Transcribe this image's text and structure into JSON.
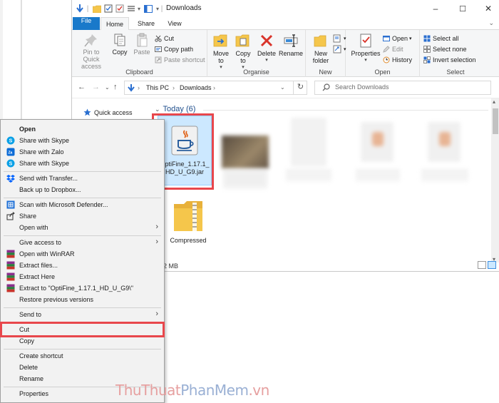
{
  "window": {
    "title": "Downloads",
    "controls": {
      "minimize": "–",
      "maximize": "☐",
      "close": "✕"
    }
  },
  "tabs": [
    {
      "label": "File"
    },
    {
      "label": "Home"
    },
    {
      "label": "Share"
    },
    {
      "label": "View"
    }
  ],
  "ribbon": {
    "clipboard": {
      "label": "Clipboard",
      "pin": "Pin to Quick access",
      "copy": "Copy",
      "paste": "Paste",
      "cut": "Cut",
      "copy_path": "Copy path",
      "paste_shortcut": "Paste shortcut"
    },
    "organise": {
      "label": "Organise",
      "move_to": "Move to",
      "copy_to": "Copy to",
      "delete": "Delete",
      "rename": "Rename"
    },
    "new": {
      "label": "New",
      "new_folder": "New folder"
    },
    "open": {
      "label": "Open",
      "properties": "Properties",
      "open": "Open",
      "edit": "Edit",
      "history": "History"
    },
    "select": {
      "label": "Select",
      "select_all": "Select all",
      "select_none": "Select none",
      "invert": "Invert selection"
    }
  },
  "address": {
    "crumbs": [
      "This PC",
      "Downloads"
    ],
    "search_placeholder": "Search Downloads"
  },
  "nav": {
    "quick_access": "Quick access"
  },
  "content": {
    "group_header": "Today (6)",
    "files": [
      {
        "name": "OptiFine_1.17.1_HD_U_G9.jar",
        "line1": "OptiFine_1.17.1_",
        "line2": "HD_U_G9.jar"
      },
      {
        "name": "Compressed"
      }
    ]
  },
  "status": {
    "size": "2 MB"
  },
  "context_menu": {
    "items": [
      {
        "label": "Open",
        "bold": true
      },
      {
        "label": "Share with Skype"
      },
      {
        "label": "Share with Zalo"
      },
      {
        "label": "Share with Skype"
      },
      {
        "label": "Send with Transfer..."
      },
      {
        "label": "Back up to Dropbox..."
      },
      {
        "label": "Scan with Microsoft Defender..."
      },
      {
        "label": "Share"
      },
      {
        "label": "Open with"
      },
      {
        "label": "Give access to"
      },
      {
        "label": "Open with WinRAR"
      },
      {
        "label": "Extract files..."
      },
      {
        "label": "Extract Here"
      },
      {
        "label": "Extract to \"OptiFine_1.17.1_HD_U_G9\\\""
      },
      {
        "label": "Restore previous versions"
      },
      {
        "label": "Send to"
      },
      {
        "label": "Cut"
      },
      {
        "label": "Copy"
      },
      {
        "label": "Create shortcut"
      },
      {
        "label": "Delete"
      },
      {
        "label": "Rename"
      },
      {
        "label": "Properties"
      }
    ]
  },
  "watermark": {
    "part1": "ThuThuat",
    "part2": "PhanMem",
    "part3": ".vn"
  },
  "colors": {
    "accent": "#1979ca",
    "highlight": "#e8474c",
    "selection": "#cce8ff",
    "folder": "#f5c64b"
  }
}
